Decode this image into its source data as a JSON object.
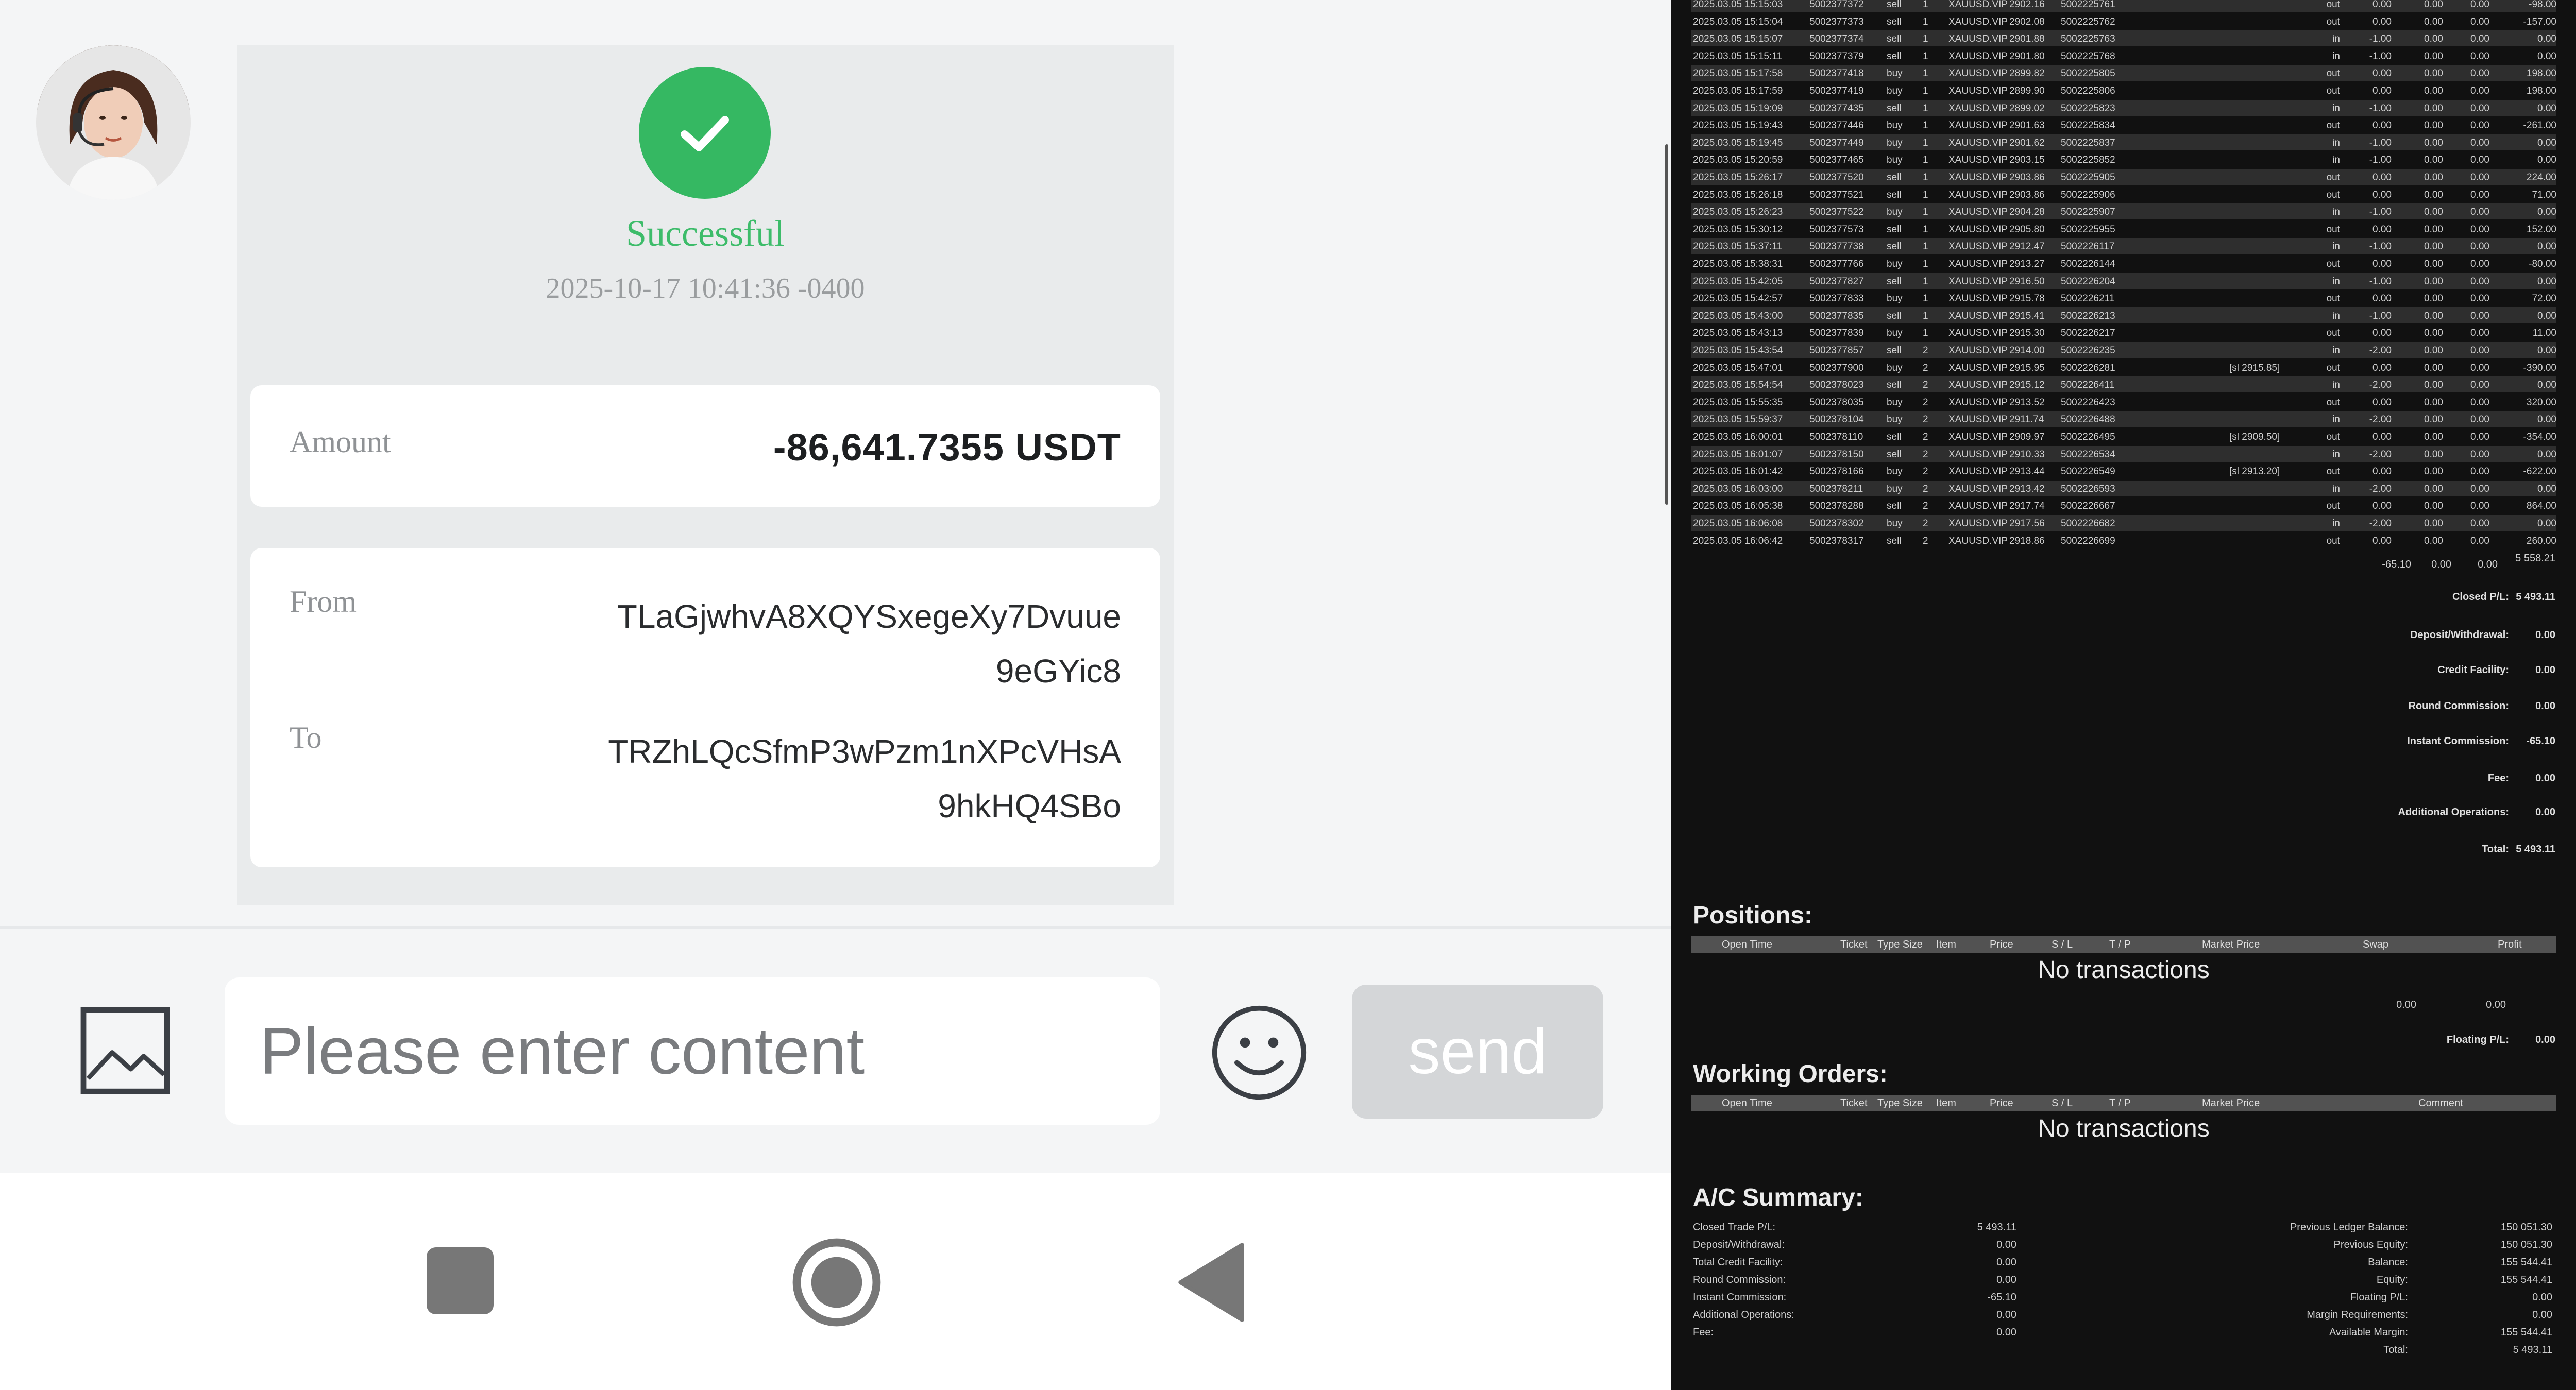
{
  "chat": {
    "status": "Successful",
    "timestamp": "2025-10-17 10:41:36 -0400",
    "amount_label": "Amount",
    "amount_value": "-86,641.7355 USDT",
    "from_label": "From",
    "from_value": "TLaGjwhvA8XQYSxegeXy7Dvuue9eGYic8",
    "to_label": "To",
    "to_value": "TRZhLQcSfmP3wPzm1nXPcVHsA9hkHQ4SBo",
    "input_placeholder": "Please enter content",
    "send_label": "send",
    "colors": {
      "success": "#35b862",
      "send_disabled": "#d4d6d8"
    },
    "icons": [
      "avatar",
      "check-icon",
      "image-icon",
      "emoji-icon",
      "nav-square-icon",
      "nav-circle-icon",
      "nav-back-icon"
    ]
  },
  "statement": {
    "deals": [
      [
        "2025.03.05 15:15:03",
        "5002377372",
        "sell",
        "1",
        "XAUUSD.VIP",
        "2902.16",
        "5002225761",
        "",
        "out",
        "0.00",
        "0.00",
        "0.00",
        "-98.00"
      ],
      [
        "2025.03.05 15:15:04",
        "5002377373",
        "sell",
        "1",
        "XAUUSD.VIP",
        "2902.08",
        "5002225762",
        "",
        "out",
        "0.00",
        "0.00",
        "0.00",
        "-157.00"
      ],
      [
        "2025.03.05 15:15:07",
        "5002377374",
        "sell",
        "1",
        "XAUUSD.VIP",
        "2901.88",
        "5002225763",
        "",
        "in",
        "-1.00",
        "0.00",
        "0.00",
        "0.00"
      ],
      [
        "2025.03.05 15:15:11",
        "5002377379",
        "sell",
        "1",
        "XAUUSD.VIP",
        "2901.80",
        "5002225768",
        "",
        "in",
        "-1.00",
        "0.00",
        "0.00",
        "0.00"
      ],
      [
        "2025.03.05 15:17:58",
        "5002377418",
        "buy",
        "1",
        "XAUUSD.VIP",
        "2899.82",
        "5002225805",
        "",
        "out",
        "0.00",
        "0.00",
        "0.00",
        "198.00"
      ],
      [
        "2025.03.05 15:17:59",
        "5002377419",
        "buy",
        "1",
        "XAUUSD.VIP",
        "2899.90",
        "5002225806",
        "",
        "out",
        "0.00",
        "0.00",
        "0.00",
        "198.00"
      ],
      [
        "2025.03.05 15:19:09",
        "5002377435",
        "sell",
        "1",
        "XAUUSD.VIP",
        "2899.02",
        "5002225823",
        "",
        "in",
        "-1.00",
        "0.00",
        "0.00",
        "0.00"
      ],
      [
        "2025.03.05 15:19:43",
        "5002377446",
        "buy",
        "1",
        "XAUUSD.VIP",
        "2901.63",
        "5002225834",
        "",
        "out",
        "0.00",
        "0.00",
        "0.00",
        "-261.00"
      ],
      [
        "2025.03.05 15:19:45",
        "5002377449",
        "buy",
        "1",
        "XAUUSD.VIP",
        "2901.62",
        "5002225837",
        "",
        "in",
        "-1.00",
        "0.00",
        "0.00",
        "0.00"
      ],
      [
        "2025.03.05 15:20:59",
        "5002377465",
        "buy",
        "1",
        "XAUUSD.VIP",
        "2903.15",
        "5002225852",
        "",
        "in",
        "-1.00",
        "0.00",
        "0.00",
        "0.00"
      ],
      [
        "2025.03.05 15:26:17",
        "5002377520",
        "sell",
        "1",
        "XAUUSD.VIP",
        "2903.86",
        "5002225905",
        "",
        "out",
        "0.00",
        "0.00",
        "0.00",
        "224.00"
      ],
      [
        "2025.03.05 15:26:18",
        "5002377521",
        "sell",
        "1",
        "XAUUSD.VIP",
        "2903.86",
        "5002225906",
        "",
        "out",
        "0.00",
        "0.00",
        "0.00",
        "71.00"
      ],
      [
        "2025.03.05 15:26:23",
        "5002377522",
        "buy",
        "1",
        "XAUUSD.VIP",
        "2904.28",
        "5002225907",
        "",
        "in",
        "-1.00",
        "0.00",
        "0.00",
        "0.00"
      ],
      [
        "2025.03.05 15:30:12",
        "5002377573",
        "sell",
        "1",
        "XAUUSD.VIP",
        "2905.80",
        "5002225955",
        "",
        "out",
        "0.00",
        "0.00",
        "0.00",
        "152.00"
      ],
      [
        "2025.03.05 15:37:11",
        "5002377738",
        "sell",
        "1",
        "XAUUSD.VIP",
        "2912.47",
        "5002226117",
        "",
        "in",
        "-1.00",
        "0.00",
        "0.00",
        "0.00"
      ],
      [
        "2025.03.05 15:38:31",
        "5002377766",
        "buy",
        "1",
        "XAUUSD.VIP",
        "2913.27",
        "5002226144",
        "",
        "out",
        "0.00",
        "0.00",
        "0.00",
        "-80.00"
      ],
      [
        "2025.03.05 15:42:05",
        "5002377827",
        "sell",
        "1",
        "XAUUSD.VIP",
        "2916.50",
        "5002226204",
        "",
        "in",
        "-1.00",
        "0.00",
        "0.00",
        "0.00"
      ],
      [
        "2025.03.05 15:42:57",
        "5002377833",
        "buy",
        "1",
        "XAUUSD.VIP",
        "2915.78",
        "5002226211",
        "",
        "out",
        "0.00",
        "0.00",
        "0.00",
        "72.00"
      ],
      [
        "2025.03.05 15:43:00",
        "5002377835",
        "sell",
        "1",
        "XAUUSD.VIP",
        "2915.41",
        "5002226213",
        "",
        "in",
        "-1.00",
        "0.00",
        "0.00",
        "0.00"
      ],
      [
        "2025.03.05 15:43:13",
        "5002377839",
        "buy",
        "1",
        "XAUUSD.VIP",
        "2915.30",
        "5002226217",
        "",
        "out",
        "0.00",
        "0.00",
        "0.00",
        "11.00"
      ],
      [
        "2025.03.05 15:43:54",
        "5002377857",
        "sell",
        "2",
        "XAUUSD.VIP",
        "2914.00",
        "5002226235",
        "",
        "in",
        "-2.00",
        "0.00",
        "0.00",
        "0.00"
      ],
      [
        "2025.03.05 15:47:01",
        "5002377900",
        "buy",
        "2",
        "XAUUSD.VIP",
        "2915.95",
        "5002226281",
        "[sl 2915.85]",
        "out",
        "0.00",
        "0.00",
        "0.00",
        "-390.00"
      ],
      [
        "2025.03.05 15:54:54",
        "5002378023",
        "sell",
        "2",
        "XAUUSD.VIP",
        "2915.12",
        "5002226411",
        "",
        "in",
        "-2.00",
        "0.00",
        "0.00",
        "0.00"
      ],
      [
        "2025.03.05 15:55:35",
        "5002378035",
        "buy",
        "2",
        "XAUUSD.VIP",
        "2913.52",
        "5002226423",
        "",
        "out",
        "0.00",
        "0.00",
        "0.00",
        "320.00"
      ],
      [
        "2025.03.05 15:59:37",
        "5002378104",
        "buy",
        "2",
        "XAUUSD.VIP",
        "2911.74",
        "5002226488",
        "",
        "in",
        "-2.00",
        "0.00",
        "0.00",
        "0.00"
      ],
      [
        "2025.03.05 16:00:01",
        "5002378110",
        "sell",
        "2",
        "XAUUSD.VIP",
        "2909.97",
        "5002226495",
        "[sl 2909.50]",
        "out",
        "0.00",
        "0.00",
        "0.00",
        "-354.00"
      ],
      [
        "2025.03.05 16:01:07",
        "5002378150",
        "sell",
        "2",
        "XAUUSD.VIP",
        "2910.33",
        "5002226534",
        "",
        "in",
        "-2.00",
        "0.00",
        "0.00",
        "0.00"
      ],
      [
        "2025.03.05 16:01:42",
        "5002378166",
        "buy",
        "2",
        "XAUUSD.VIP",
        "2913.44",
        "5002226549",
        "[sl 2913.20]",
        "out",
        "0.00",
        "0.00",
        "0.00",
        "-622.00"
      ],
      [
        "2025.03.05 16:03:00",
        "5002378211",
        "buy",
        "2",
        "XAUUSD.VIP",
        "2913.42",
        "5002226593",
        "",
        "in",
        "-2.00",
        "0.00",
        "0.00",
        "0.00"
      ],
      [
        "2025.03.05 16:05:38",
        "5002378288",
        "sell",
        "2",
        "XAUUSD.VIP",
        "2917.74",
        "5002226667",
        "",
        "out",
        "0.00",
        "0.00",
        "0.00",
        "864.00"
      ],
      [
        "2025.03.05 16:06:08",
        "5002378302",
        "buy",
        "2",
        "XAUUSD.VIP",
        "2917.56",
        "5002226682",
        "",
        "in",
        "-2.00",
        "0.00",
        "0.00",
        "0.00"
      ],
      [
        "2025.03.05 16:06:42",
        "5002378317",
        "sell",
        "2",
        "XAUUSD.VIP",
        "2918.86",
        "5002226699",
        "",
        "out",
        "0.00",
        "0.00",
        "0.00",
        "260.00"
      ]
    ],
    "totals": {
      "commission": "-65.10",
      "fee": "0.00",
      "swap": "0.00",
      "profit": "5 558.21"
    },
    "closed_summary": [
      {
        "label": "Closed P/L:",
        "value": "5 493.11"
      },
      {
        "label": "Deposit/Withdrawal:",
        "value": "0.00"
      },
      {
        "label": "Credit Facility:",
        "value": "0.00"
      },
      {
        "label": "Round Commission:",
        "value": "0.00"
      },
      {
        "label": "Instant Commission:",
        "value": "-65.10"
      },
      {
        "label": "Fee:",
        "value": "0.00"
      },
      {
        "label": "Additional Operations:",
        "value": "0.00"
      },
      {
        "label": "Total:",
        "value": "5 493.11"
      }
    ],
    "positions": {
      "title": "Positions:",
      "headers": [
        "Open Time",
        "Ticket",
        "Type Size",
        "Item",
        "Price",
        "S / L",
        "T / P",
        "Market Price",
        "Swap",
        "Profit"
      ],
      "empty": "No transactions",
      "swap_total": "0.00",
      "profit_total": "0.00",
      "floating_label": "Floating P/L:",
      "floating_value": "0.00"
    },
    "working_orders": {
      "title": "Working Orders:",
      "headers": [
        "Open Time",
        "Ticket",
        "Type Size",
        "Item",
        "Price",
        "S / L",
        "T / P",
        "Market Price",
        "Comment"
      ],
      "empty": "No transactions"
    },
    "ac_summary": {
      "title": "A/C Summary:",
      "left": [
        {
          "label": "Closed Trade P/L:",
          "value": "5 493.11"
        },
        {
          "label": "Deposit/Withdrawal:",
          "value": "0.00"
        },
        {
          "label": "Total Credit Facility:",
          "value": "0.00"
        },
        {
          "label": "Round Commission:",
          "value": "0.00"
        },
        {
          "label": "Instant Commission:",
          "value": "-65.10"
        },
        {
          "label": "Additional Operations:",
          "value": "0.00"
        },
        {
          "label": "Fee:",
          "value": "0.00"
        }
      ],
      "right": [
        {
          "label": "Previous Ledger Balance:",
          "value": "150 051.30"
        },
        {
          "label": "Previous Equity:",
          "value": "150 051.30"
        },
        {
          "label": "Balance:",
          "value": "155 544.41"
        },
        {
          "label": "Equity:",
          "value": "155 544.41"
        },
        {
          "label": "Floating P/L:",
          "value": "0.00"
        },
        {
          "label": "Margin Requirements:",
          "value": "0.00"
        },
        {
          "label": "Available Margin:",
          "value": "155 544.41"
        },
        {
          "label": "Total:",
          "value": "5 493.11"
        }
      ]
    }
  }
}
